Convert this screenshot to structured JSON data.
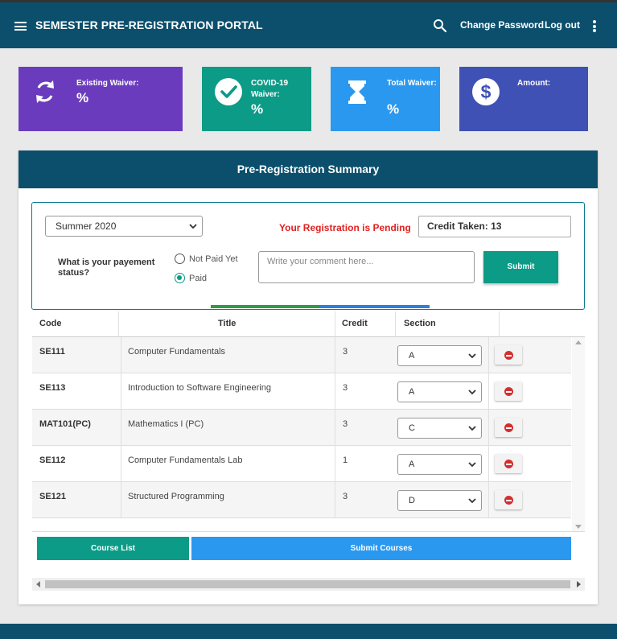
{
  "header": {
    "title": "SEMESTER PRE-REGISTRATION PORTAL",
    "change_password": "Change Password",
    "logout": "Log out",
    "icons": [
      "menu-icon",
      "search-icon",
      "more-vert-icon"
    ]
  },
  "cards": {
    "existing": {
      "label": "Existing Waiver:",
      "value": "%",
      "icon": "refresh-icon",
      "color": "#6a3cbd"
    },
    "covid": {
      "label": "COVID-19 Waiver:",
      "value": "%",
      "icon": "check-circle-icon",
      "color": "#0b9b87"
    },
    "total": {
      "label": "Total Waiver:",
      "value": "%",
      "icon": "hourglass-icon",
      "color": "#2b98ef"
    },
    "amount": {
      "label": "Amount:",
      "icon": "dollar-icon",
      "color": "#3f51b5"
    }
  },
  "summary": {
    "title": "Pre-Registration Summary",
    "semester": "Summer 2020",
    "status": "Your Registration is Pending",
    "credit_taken": "Credit Taken: 13",
    "payment_question": "What is your payement status?",
    "radio_not_paid": "Not Paid Yet",
    "radio_paid": "Paid",
    "selected_payment": "Paid",
    "comment_placeholder": "Write your comment here...",
    "submit": "Submit"
  },
  "table": {
    "headers": {
      "code": "Code",
      "title": "Title",
      "credit": "Credit",
      "section": "Section"
    },
    "rows": [
      {
        "code": "SE111",
        "title": "Computer Fundamentals",
        "credit": "3",
        "section": "A"
      },
      {
        "code": "SE113",
        "title": "Introduction to Software Engineering",
        "credit": "3",
        "section": "A"
      },
      {
        "code": "MAT101(PC)",
        "title": "Mathematics I (PC)",
        "credit": "3",
        "section": "C"
      },
      {
        "code": "SE112",
        "title": "Computer Fundamentals Lab",
        "credit": "1",
        "section": "A"
      },
      {
        "code": "SE121",
        "title": "Structured Programming",
        "credit": "3",
        "section": "D"
      }
    ]
  },
  "buttons": {
    "course_list": "Course List",
    "submit_courses": "Submit Courses"
  },
  "colors": {
    "header": "#0b4f6c",
    "teal": "#0b9b87",
    "blue": "#2b98ef",
    "pending": "#e32020"
  }
}
